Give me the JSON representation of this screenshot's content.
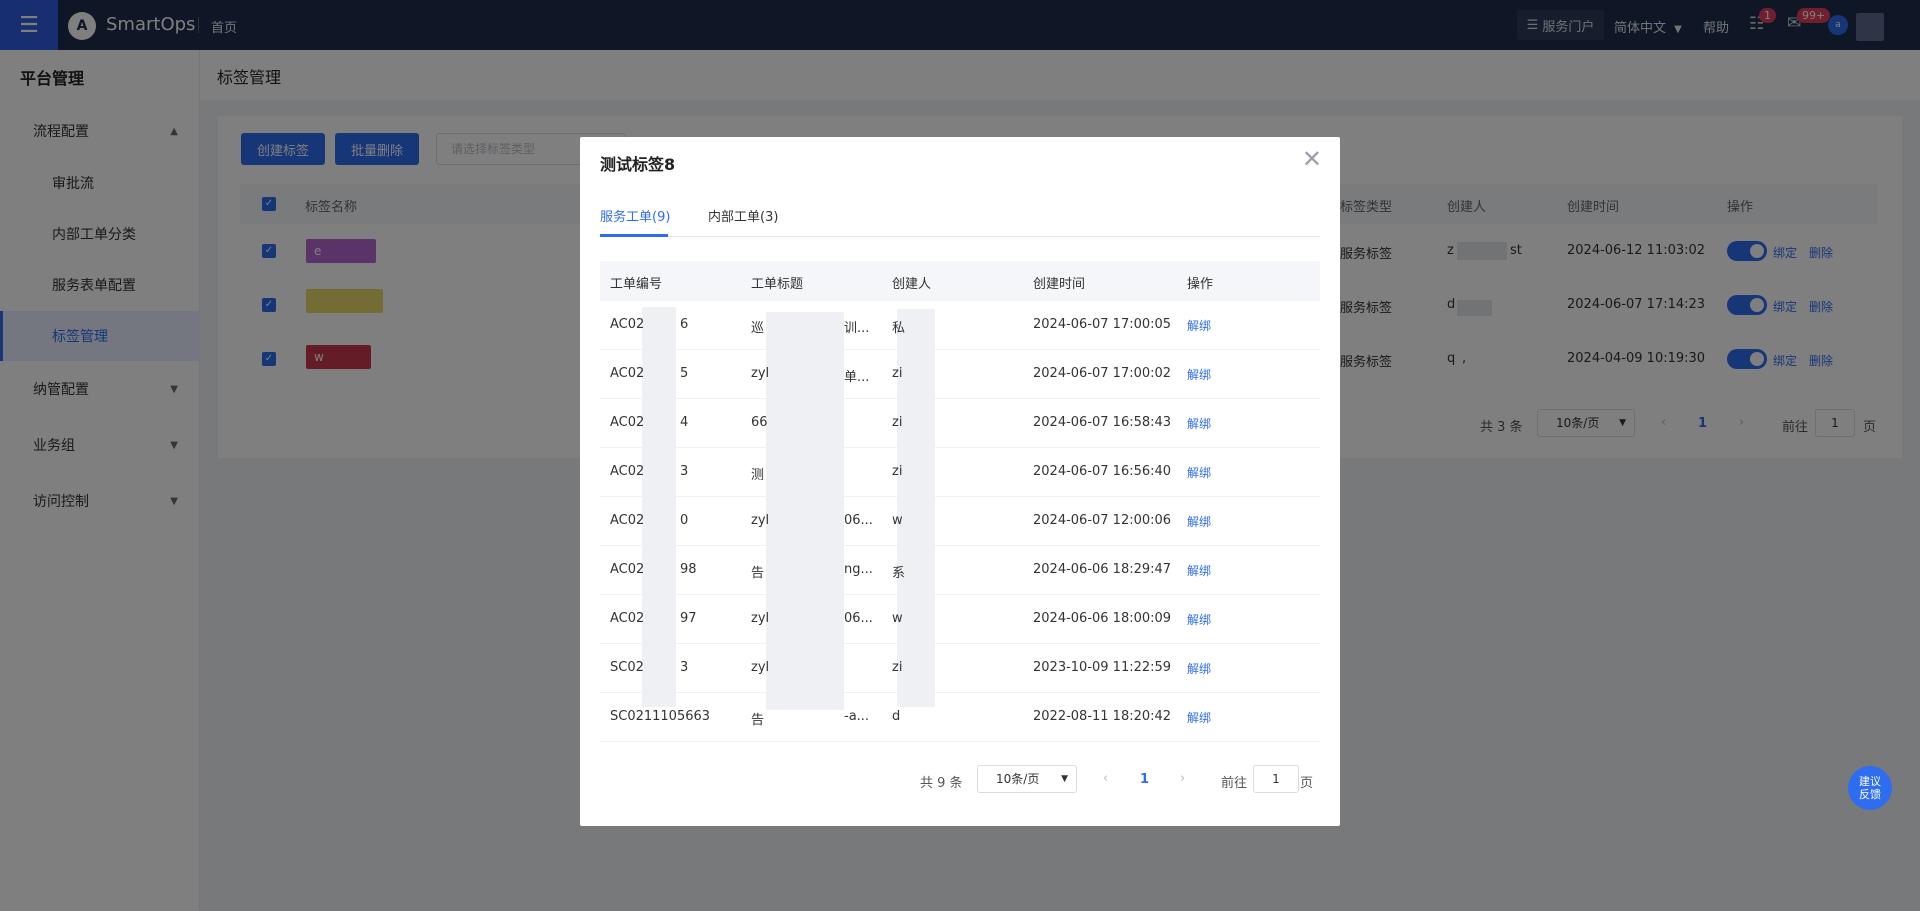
{
  "topbar": {
    "app_name": "SmartOps",
    "logo_letter": "A",
    "breadcrumb_home": "首页",
    "service_portal": "服务门户",
    "language": "简体中文",
    "help": "帮助",
    "todo_badge": "1",
    "mail_badge": "99+",
    "avatar_initial": "a"
  },
  "sidebar": {
    "title": "平台管理",
    "items": [
      {
        "label": "流程配置"
      },
      {
        "label": "审批流"
      },
      {
        "label": "内部工单分类"
      },
      {
        "label": "服务表单配置"
      },
      {
        "label": "标签管理"
      },
      {
        "label": "纳管配置"
      },
      {
        "label": "业务组"
      },
      {
        "label": "访问控制"
      }
    ]
  },
  "page": {
    "title": "标签管理",
    "create_button": "创建标签",
    "batch_delete_button": "批量删除",
    "filter_placeholder": "请选择标签类型",
    "table": {
      "headers": [
        "标签名称",
        "标签类型",
        "创建人",
        "创建时间",
        "操作"
      ],
      "rows": [
        {
          "name": "e",
          "type": "服务标签",
          "creator_a": "z",
          "creator_b": "st",
          "time": "2024-06-12 11:03:02"
        },
        {
          "name": "",
          "type": "服务标签",
          "creator_a": "d",
          "creator_b": "",
          "time": "2024-06-07 17:14:23"
        },
        {
          "name": "w",
          "type": "服务标签",
          "creator_a": "q",
          "creator_b": ",",
          "time": "2024-04-09 10:19:30"
        }
      ],
      "action_bind": "绑定",
      "action_delete": "删除"
    },
    "pagination": {
      "total": "共 3 条",
      "page_size": "10条/页",
      "current": "1",
      "goto": "前往",
      "goto_value": "1",
      "page_unit": "页"
    }
  },
  "modal": {
    "title": "测试标签8",
    "tabs": [
      "服务工单(9)",
      "内部工单(3)"
    ],
    "headers": [
      "工单编号",
      "工单标题",
      "创建人",
      "创建时间",
      "操作"
    ],
    "rows": [
      {
        "id_a": "AC02",
        "id_b": "6",
        "title_a": "巡",
        "title_b": "训...",
        "creator": "私",
        "time": "2024-06-07 17:00:05",
        "action": "解绑"
      },
      {
        "id_a": "AC02",
        "id_b": "5",
        "title_a": "zyl",
        "title_b": "单...",
        "creator": "zi",
        "time": "2024-06-07 17:00:02",
        "action": "解绑"
      },
      {
        "id_a": "AC02",
        "id_b": "4",
        "title_a": "66",
        "title_b": "",
        "creator": "zi",
        "time": "2024-06-07 16:58:43",
        "action": "解绑"
      },
      {
        "id_a": "AC02",
        "id_b": "3",
        "title_a": "测",
        "title_b": "",
        "creator": "zi",
        "time": "2024-06-07 16:56:40",
        "action": "解绑"
      },
      {
        "id_a": "AC02",
        "id_b": "0",
        "title_a": "zyl",
        "title_b": "06...",
        "creator": "w",
        "time": "2024-06-07 12:00:06",
        "action": "解绑"
      },
      {
        "id_a": "AC02",
        "id_b": "98",
        "title_a": "告",
        "title_b": "ng...",
        "creator": "系",
        "time": "2024-06-06 18:29:47",
        "action": "解绑"
      },
      {
        "id_a": "AC02",
        "id_b": "97",
        "title_a": "zyl",
        "title_b": "06...",
        "creator": "w",
        "time": "2024-06-06 18:00:09",
        "action": "解绑"
      },
      {
        "id_a": "SC02",
        "id_b": "3",
        "title_a": "zyl",
        "title_b": "",
        "creator": "zi",
        "time": "2023-10-09 11:22:59",
        "action": "解绑"
      },
      {
        "id_a": "SC0211105663",
        "id_b": "",
        "title_a": "告",
        "title_b": "-a...",
        "creator": "d",
        "time": "2022-08-11 18:20:42",
        "action": "解绑"
      }
    ],
    "pagination": {
      "total": "共 9 条",
      "page_size": "10条/页",
      "current": "1",
      "goto": "前往",
      "goto_value": "1",
      "page_unit": "页"
    }
  },
  "feedback": {
    "line1": "建议",
    "line2": "反馈"
  }
}
